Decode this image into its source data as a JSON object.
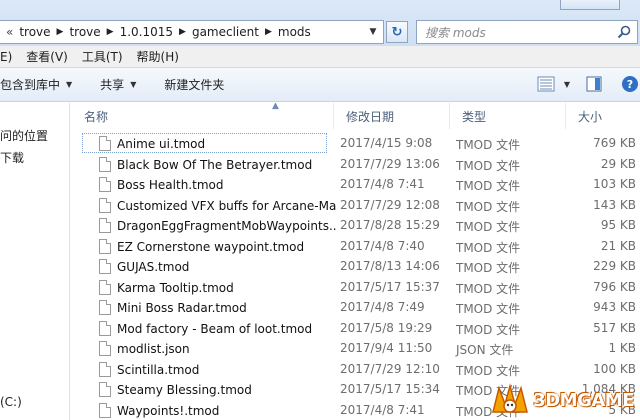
{
  "address": {
    "chevron": "«",
    "crumbs": [
      "trove",
      "trove",
      "1.0.1015",
      "gameclient",
      "mods"
    ],
    "refresh_symbol": "↻"
  },
  "search": {
    "placeholder": "搜索 mods"
  },
  "menu": {
    "items": [
      "E)",
      "查看(V)",
      "工具(T)",
      "帮助(H)"
    ]
  },
  "toolbar": {
    "include_label": "包含到库中",
    "share_label": "共享",
    "new_folder_label": "新建文件夹"
  },
  "nav": {
    "items": [
      "问的位置",
      "下载",
      "(C:)"
    ]
  },
  "columns": {
    "name": "名称",
    "date": "修改日期",
    "type": "类型",
    "size": "大小"
  },
  "files": [
    {
      "name": "Anime ui.tmod",
      "date": "2017/4/15 9:08",
      "type": "TMOD 文件",
      "size": "769 KB"
    },
    {
      "name": "Black Bow Of The Betrayer.tmod",
      "date": "2017/7/29 13:06",
      "type": "TMOD 文件",
      "size": "29 KB"
    },
    {
      "name": "Boss Health.tmod",
      "date": "2017/4/8 7:41",
      "type": "TMOD 文件",
      "size": "103 KB"
    },
    {
      "name": "Customized VFX buffs for Arcane-Ma...",
      "date": "2017/7/29 12:08",
      "type": "TMOD 文件",
      "size": "143 KB"
    },
    {
      "name": "DragonEggFragmentMobWaypoints....",
      "date": "2017/8/28 15:29",
      "type": "TMOD 文件",
      "size": "95 KB"
    },
    {
      "name": "EZ Cornerstone waypoint.tmod",
      "date": "2017/4/8 7:40",
      "type": "TMOD 文件",
      "size": "21 KB"
    },
    {
      "name": "GUJAS.tmod",
      "date": "2017/8/13 14:06",
      "type": "TMOD 文件",
      "size": "229 KB"
    },
    {
      "name": "Karma Tooltip.tmod",
      "date": "2017/5/17 15:37",
      "type": "TMOD 文件",
      "size": "796 KB"
    },
    {
      "name": "Mini Boss Radar.tmod",
      "date": "2017/4/8 7:49",
      "type": "TMOD 文件",
      "size": "943 KB"
    },
    {
      "name": "Mod factory - Beam of loot.tmod",
      "date": "2017/5/8 19:29",
      "type": "TMOD 文件",
      "size": "517 KB"
    },
    {
      "name": "modlist.json",
      "date": "2017/9/4 11:50",
      "type": "JSON 文件",
      "size": "1 KB"
    },
    {
      "name": "Scintilla.tmod",
      "date": "2017/7/29 12:10",
      "type": "TMOD 文件",
      "size": "100 KB"
    },
    {
      "name": "Steamy Blessing.tmod",
      "date": "2017/5/17 15:34",
      "type": "TMOD 文件",
      "size": "1,084 KB"
    },
    {
      "name": "Waypoints!.tmod",
      "date": "2017/4/8 7:41",
      "type": "TMOD 文件",
      "size": "5 KB"
    }
  ],
  "watermark": {
    "text": "3DMGAME"
  },
  "colors": {
    "accent": "#2a63b8",
    "header_text": "#4c607a",
    "muted_text": "#6d6d6d"
  }
}
